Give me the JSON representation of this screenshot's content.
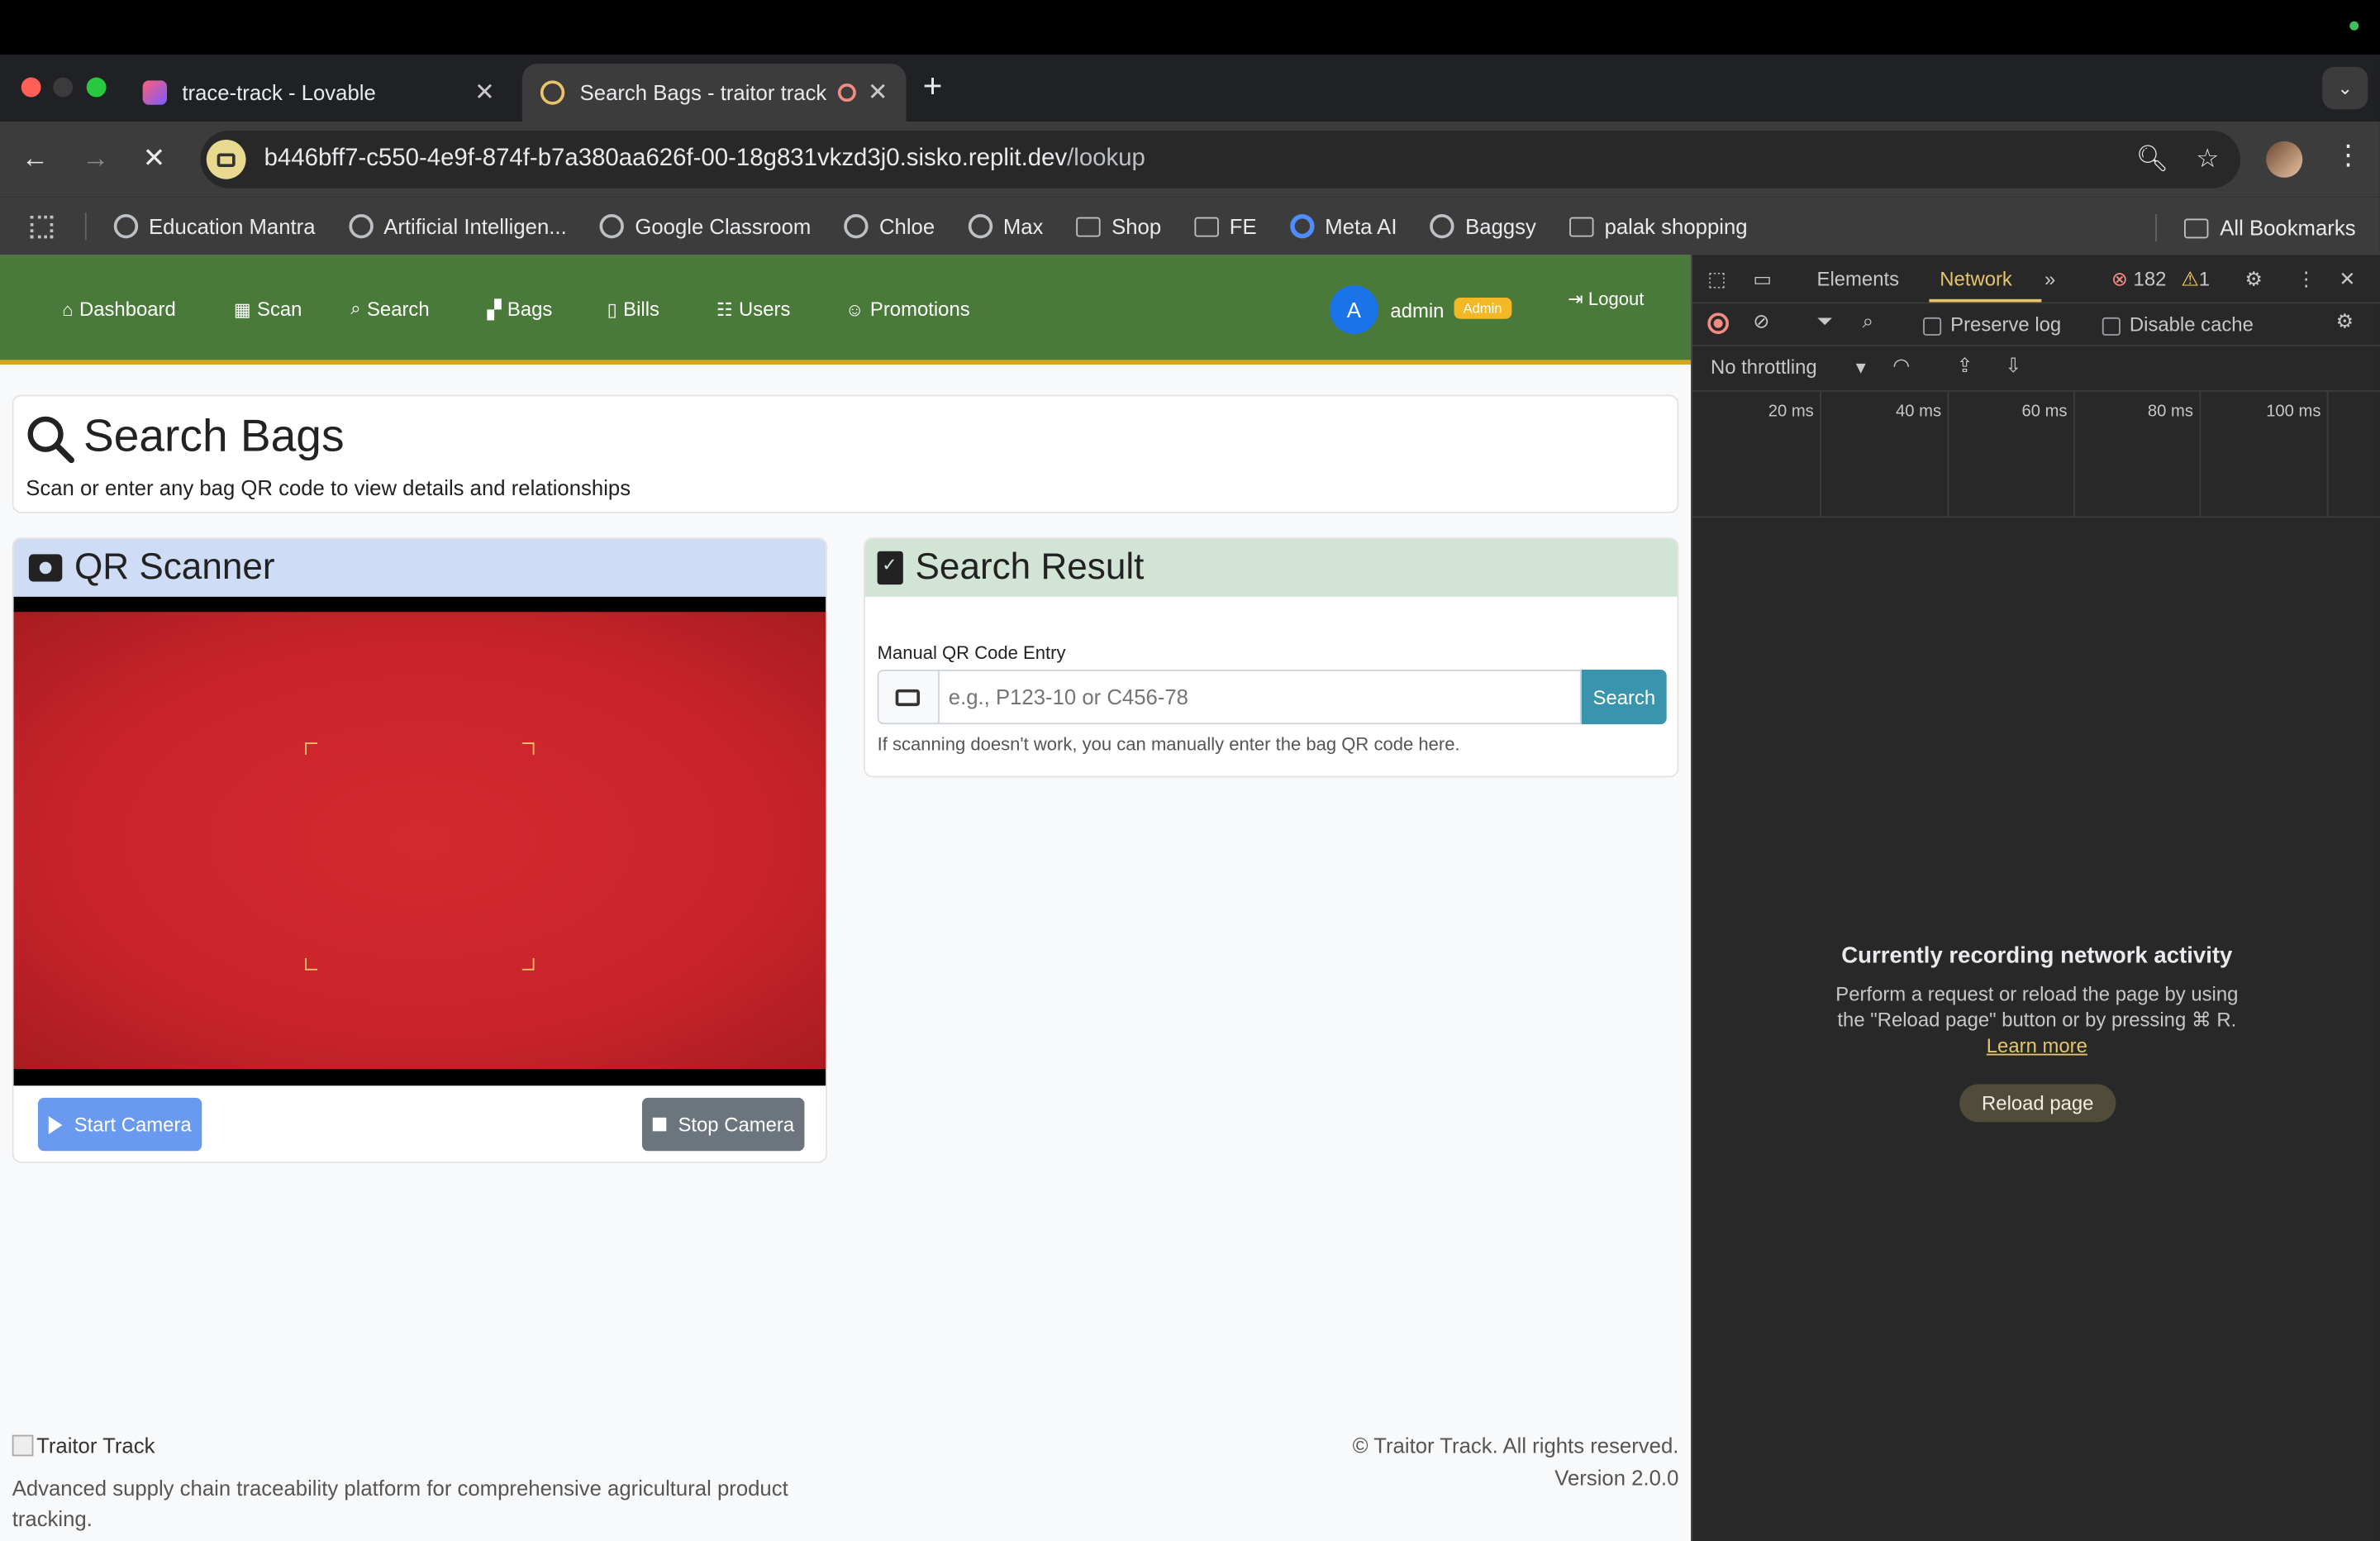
{
  "browser": {
    "tabs": [
      {
        "title": "trace-track - Lovable",
        "active": false
      },
      {
        "title": "Search Bags - traitor track",
        "active": true
      }
    ],
    "new_tab": "+",
    "url_host": "b446bff7-c550-4e9f-874f-b7a380aa626f-00-18g831vkzd3j0.sisko.replit.dev",
    "url_path": "/lookup",
    "bookmarks": [
      "Education Mantra",
      "Artificial Intelligen...",
      "Google Classroom",
      "Chloe",
      "Max",
      "Shop",
      "FE",
      "Meta AI",
      "Baggsy",
      "palak shopping"
    ],
    "all_bookmarks": "All Bookmarks"
  },
  "app": {
    "nav": [
      "Dashboard",
      "Scan",
      "Search",
      "Bags",
      "Bills",
      "Users",
      "Promotions"
    ],
    "user_initial": "A",
    "username": "admin",
    "role": "Admin",
    "logout": "Logout"
  },
  "header": {
    "title": "Search Bags",
    "subtitle": "Scan or enter any bag QR code to view details and relationships"
  },
  "scanner": {
    "title": "QR Scanner",
    "start": "Start Camera",
    "stop": "Stop Camera"
  },
  "result": {
    "title": "Search Result",
    "label": "Manual QR Code Entry",
    "placeholder": "e.g., P123-10 or C456-78",
    "search": "Search",
    "help": "If scanning doesn't work, you can manually enter the bag QR code here."
  },
  "footer": {
    "logo_alt": "Traitor Track",
    "description": "Advanced supply chain traceability platform for comprehensive agricultural product tracking.",
    "copyright": "© Traitor Track. All rights reserved.",
    "version": "Version 2.0.0"
  },
  "devtools": {
    "tabs": [
      "Elements",
      "Network"
    ],
    "errors": "182",
    "warnings": "1",
    "preserve_log": "Preserve log",
    "disable_cache": "Disable cache",
    "throttling": "No throttling",
    "ticks": [
      "20 ms",
      "40 ms",
      "60 ms",
      "80 ms",
      "100 ms"
    ],
    "empty_title": "Currently recording network activity",
    "empty_text": "Perform a request or reload the page by using the \"Reload page\" button or by pressing ⌘ R.",
    "learn_more": "Learn more",
    "reload": "Reload page"
  },
  "colors": {
    "nav_green": "#4a7a3a",
    "accent_gold": "#d9a521",
    "scanner_head": "#cfdcf6",
    "result_head": "#d1e4d6",
    "video_red": "#c8242a"
  }
}
